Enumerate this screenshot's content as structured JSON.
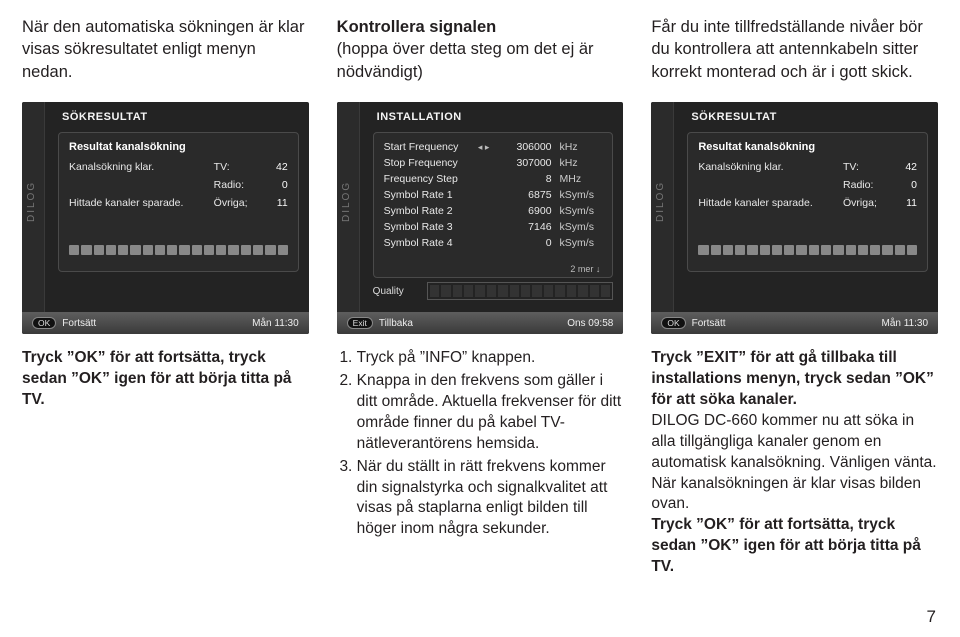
{
  "top": {
    "left": "När den automatiska sökningen är klar visas sökresultatet enligt menyn nedan.",
    "mid_title": "Kontrollera signalen",
    "mid_sub": "(hoppa över detta steg om det ej är nödvändigt)",
    "right": "Får du inte tillfredställande nivåer bör du kontrollera att antennkabeln sitter korrekt monterad och är i gott skick."
  },
  "panelA": {
    "title": "SÖKRESULTAT",
    "head": "Resultat kanalsökning",
    "l1": "Kanalsökning klar.",
    "l2": "Hittade kanaler sparade.",
    "tv_l": "TV:",
    "tv_v": "42",
    "ra_l": "Radio:",
    "ra_v": "0",
    "ov_l": "Övriga;",
    "ov_v": "11",
    "ok": "OK",
    "cont": "Fortsätt",
    "clock": "Mån 11:30",
    "brand": "DILOG"
  },
  "panelB": {
    "title": "INSTALLATION",
    "rows": [
      {
        "lab": "Start Frequency",
        "arrow": true,
        "val": "306000",
        "unit": "kHz"
      },
      {
        "lab": "Stop Frequency",
        "val": "307000",
        "unit": "kHz"
      },
      {
        "lab": "Frequency Step",
        "val": "8",
        "unit": "MHz"
      },
      {
        "lab": "Symbol Rate 1",
        "val": "6875",
        "unit": "kSym/s"
      },
      {
        "lab": "Symbol Rate 2",
        "val": "6900",
        "unit": "kSym/s"
      },
      {
        "lab": "Symbol Rate 3",
        "val": "7146",
        "unit": "kSym/s"
      },
      {
        "lab": "Symbol Rate 4",
        "val": "0",
        "unit": "kSym/s"
      }
    ],
    "more": "2 mer ↓",
    "quality": "Quality",
    "exit": "Exit",
    "back": "Tillbaka",
    "clock": "Ons 09:58",
    "brand": "DILOG"
  },
  "panelC": {
    "title": "SÖKRESULTAT",
    "head": "Resultat kanalsökning",
    "l1": "Kanalsökning klar.",
    "l2": "Hittade kanaler sparade.",
    "tv_l": "TV:",
    "tv_v": "42",
    "ra_l": "Radio:",
    "ra_v": "0",
    "ov_l": "Övriga;",
    "ov_v": "11",
    "ok": "OK",
    "cont": "Fortsätt",
    "clock": "Mån 11:30",
    "brand": "DILOG"
  },
  "bottom": {
    "left": "Tryck ”OK” för att fortsätta, tryck sedan ”OK” igen för att börja titta på TV.",
    "mid": {
      "i1": "Tryck på ”INFO” knappen.",
      "i2": "Knappa in den frekvens som gäller i ditt område. Aktuella frekvenser för ditt område finner du på  kabel TV-nätleverantörens hemsida.",
      "i3": "När du ställt in rätt frekvens kommer din signalstyrka och signalkvalitet att visas på staplarna enligt bilden till höger inom några sekunder."
    },
    "right": {
      "p1": "Tryck ”EXIT” för att gå tillbaka till installations menyn, tryck sedan ”OK” för att söka kanaler.",
      "p2": "DILOG DC-660 kommer nu att söka in alla tillgängliga kanaler genom en automatisk kanalsökning. Vänligen vänta.",
      "p3": "När kanalsökningen är klar visas bilden ovan.",
      "p4": "Tryck ”OK” för att fortsätta, tryck sedan ”OK” igen för att börja titta på TV."
    }
  },
  "page_number": "7"
}
